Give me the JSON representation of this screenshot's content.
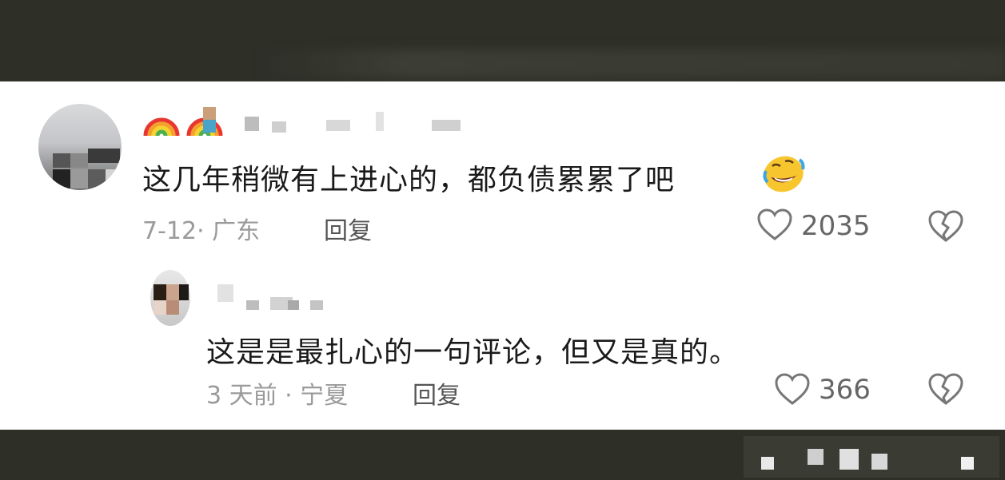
{
  "comments": [
    {
      "text": "这几年稍微有上进心的，都负债累累了吧",
      "emoji": "rolling-on-floor-laughing-emoji",
      "date_location": "7-12· 广东",
      "reply_label": "回复",
      "likes": "2035"
    },
    {
      "text": "这是是最扎心的一句评论，但又是真的。",
      "date_location": "3 天前 · 宁夏",
      "reply_label": "回复",
      "likes": "366"
    }
  ],
  "icons": {
    "like": "heart-outline-icon",
    "dislike": "broken-heart-icon",
    "badge": "rainbow-icon"
  },
  "colors": {
    "panel_background": "#ffffff",
    "frame_background": "#2e2f27",
    "text_primary": "#1a1a1a",
    "text_meta": "#9a9a9a"
  }
}
